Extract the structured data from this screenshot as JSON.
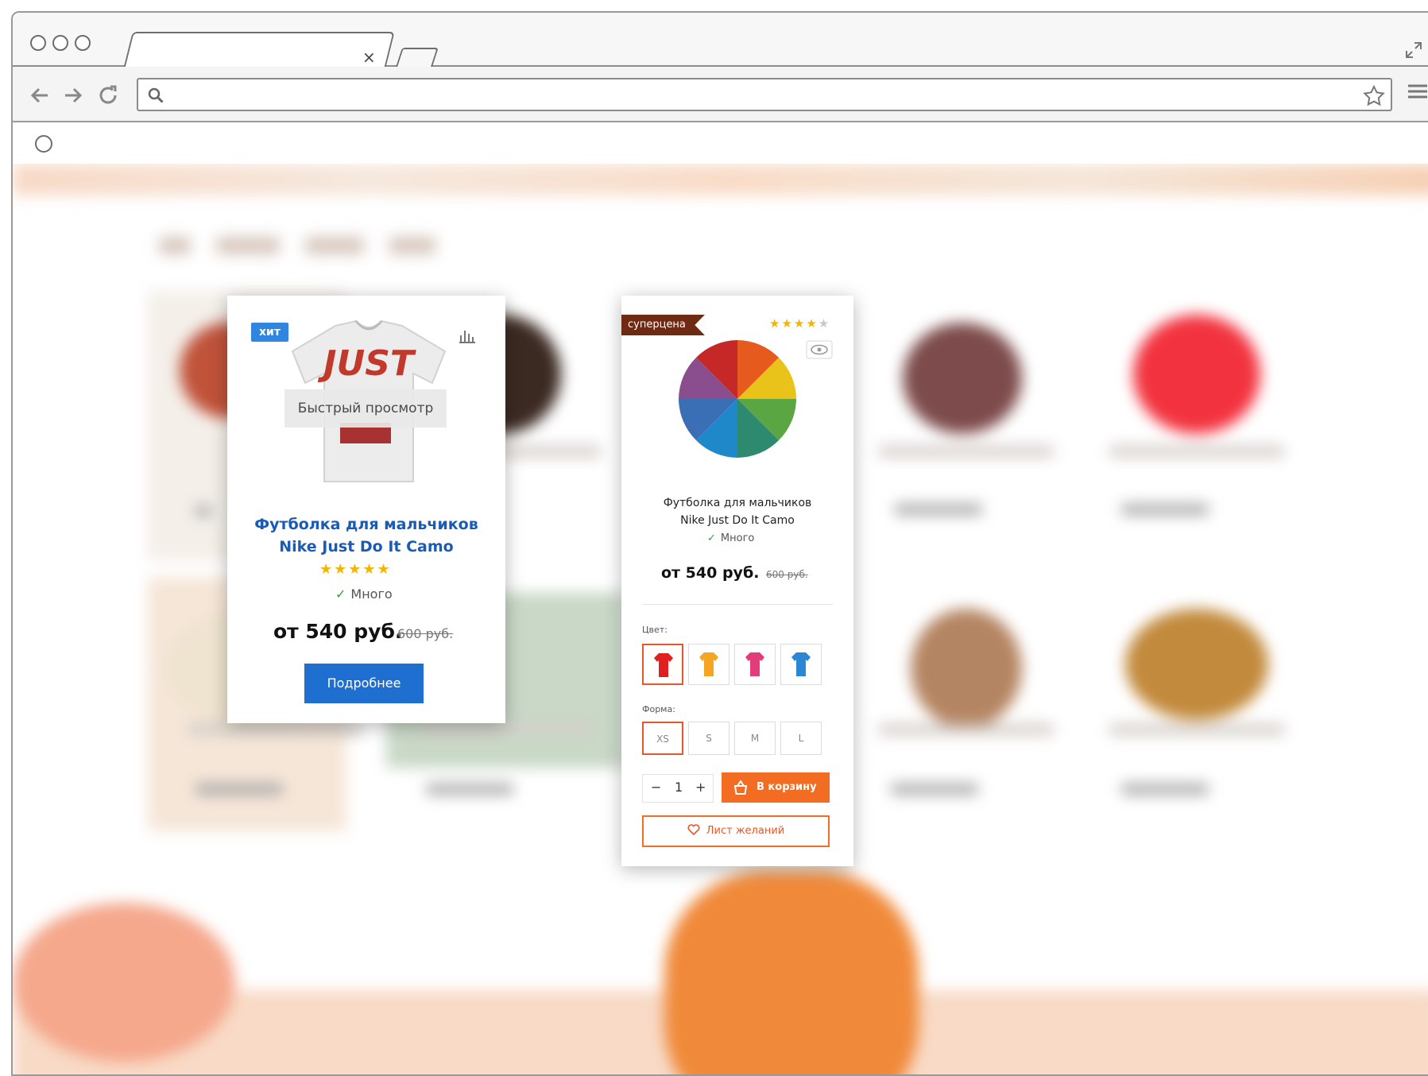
{
  "browser": {
    "tab_close": "×",
    "url_value": ""
  },
  "quick_card": {
    "badge": "хит",
    "image_icon": "tshirt-image",
    "quick_view_label": "Быстрый просмотр",
    "title_line1": "Футболка для мальчиков",
    "title_line2": "Nike Just Do It Camo",
    "rating": 5,
    "stars": "★★★★★",
    "stock": "Много",
    "price": "от 540 руб.",
    "old_price": "600 руб.",
    "details_button": "Подробнее"
  },
  "product_card": {
    "badge": "суперцена",
    "rating": 4,
    "stars_filled": "★★★★",
    "stars_empty": "★",
    "image_icon": "rainbow-cake-image",
    "title_line1": "Футболка для мальчиков",
    "title_line2": "Nike Just Do It Camo",
    "stock": "Много",
    "price": "от 540 руб.",
    "old_price": "600 руб.",
    "color_label": "Цвет:",
    "colors": [
      {
        "name": "red",
        "hex": "#e02020",
        "selected": true
      },
      {
        "name": "yellow",
        "hex": "#f4a623",
        "selected": false
      },
      {
        "name": "pink",
        "hex": "#e23c7a",
        "selected": false
      },
      {
        "name": "blue",
        "hex": "#2b86d6",
        "selected": false
      }
    ],
    "size_label": "Форма:",
    "sizes": [
      "XS",
      "S",
      "M",
      "L"
    ],
    "selected_size": "XS",
    "qty_minus": "−",
    "quantity": "1",
    "qty_plus": "+",
    "cart_button": "В корзину",
    "wishlist_button": "Лист желаний"
  },
  "colors": {
    "accent_blue": "#1f6fd1",
    "accent_orange": "#f26d21",
    "badge_brown": "#6e2a12",
    "star_gold": "#f5b400"
  }
}
